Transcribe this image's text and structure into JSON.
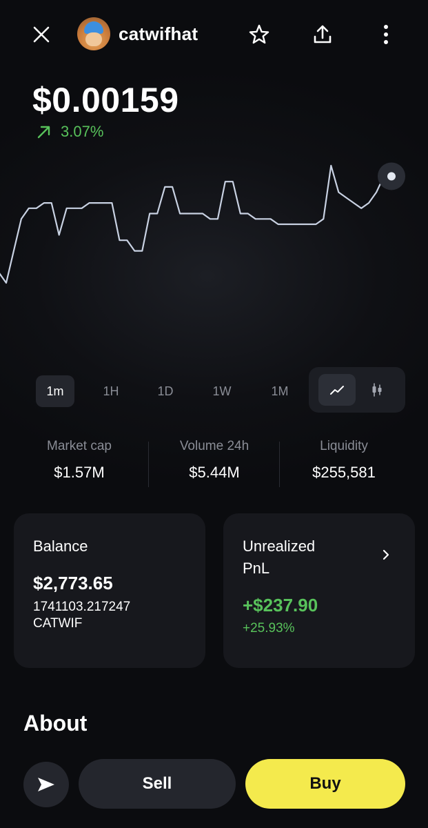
{
  "header": {
    "token_name": "catwifhat",
    "avatar_icon": "cat-with-blue-hat-avatar",
    "close_icon": "close-icon",
    "favorite_icon": "star-icon",
    "share_icon": "share-icon",
    "more_icon": "more-vertical-icon"
  },
  "price": {
    "value": "$0.00159",
    "change": "3.07%",
    "change_direction": "up",
    "change_color": "#58c25b"
  },
  "chart_data": {
    "type": "line",
    "values": [
      0.00157,
      0.001568,
      0.001574,
      0.00158,
      0.001582,
      0.001582,
      0.001583,
      0.001583,
      0.001577,
      0.001582,
      0.001582,
      0.001582,
      0.001583,
      0.001583,
      0.001583,
      0.001583,
      0.001576,
      0.001576,
      0.001574,
      0.001574,
      0.001581,
      0.001581,
      0.001586,
      0.001586,
      0.001581,
      0.001581,
      0.001581,
      0.001581,
      0.00158,
      0.00158,
      0.001587,
      0.001587,
      0.001581,
      0.001581,
      0.00158,
      0.00158,
      0.00158,
      0.001579,
      0.001579,
      0.001579,
      0.001579,
      0.001579,
      0.001579,
      0.00158,
      0.00159,
      0.001585,
      0.001584,
      0.001583,
      0.001582,
      0.001583,
      0.001585,
      0.001588,
      0.001588
    ],
    "line_color": "#c9d2e3",
    "grid": false,
    "title": "",
    "xlabel": "",
    "ylabel": ""
  },
  "ranges": {
    "items": [
      "1m",
      "1H",
      "1D",
      "1W",
      "1M"
    ],
    "active": "1m",
    "line_mode_icon": "line-chart-icon",
    "candle_mode_icon": "candlestick-chart-icon"
  },
  "stats": {
    "market_cap_label": "Market cap",
    "market_cap_value": "$1.57M",
    "volume_label": "Volume 24h",
    "volume_value": "$5.44M",
    "liquidity_label": "Liquidity",
    "liquidity_value": "$255,581"
  },
  "balance": {
    "title": "Balance",
    "amount": "$2,773.65",
    "quantity": "1741103.217247",
    "symbol": "CATWIF"
  },
  "pnl": {
    "title": "Unrealized PnL",
    "amount": "+$237.90",
    "percent": "+25.93%",
    "chevron_icon": "chevron-right-icon"
  },
  "about": {
    "heading": "About"
  },
  "actions": {
    "send_icon": "send-icon",
    "sell_label": "Sell",
    "buy_label": "Buy",
    "buy_color": "#f4ea4d"
  }
}
